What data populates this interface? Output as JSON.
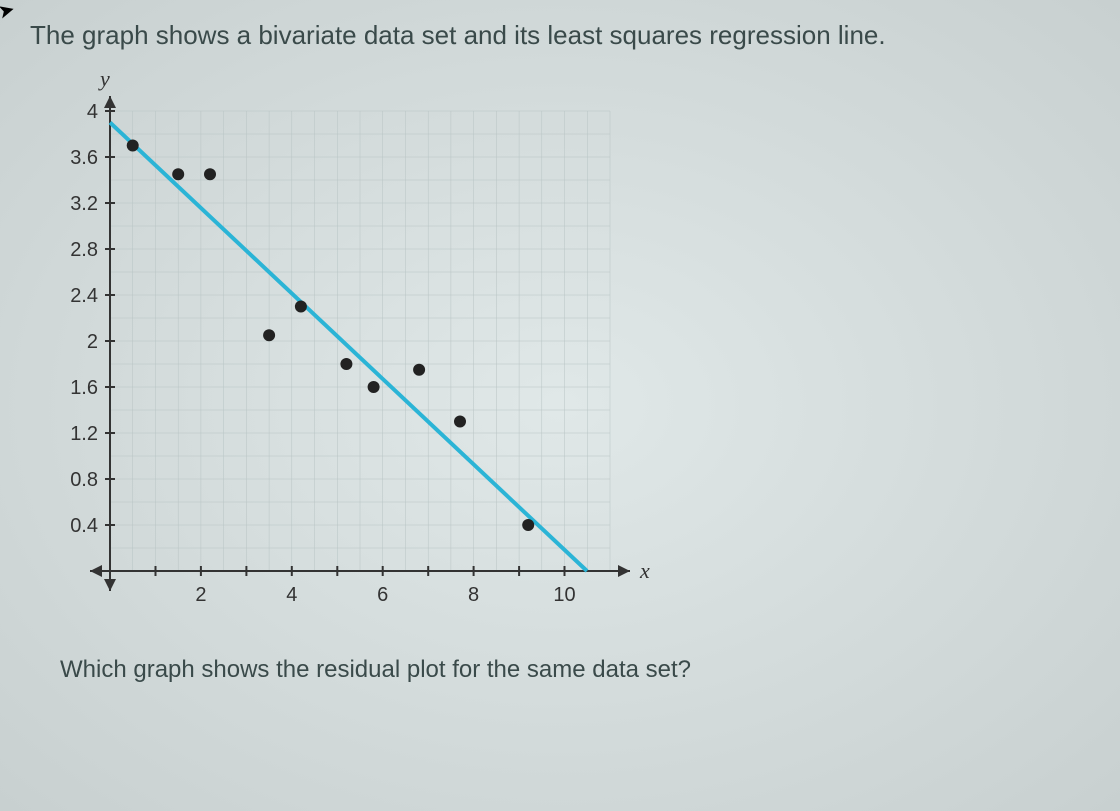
{
  "title_text": "The graph shows a bivariate data set and its least squares regression line.",
  "question_text": "Which graph shows the residual plot for the same data set?",
  "chart_data": {
    "type": "scatter",
    "title": "",
    "xlabel": "x",
    "ylabel": "y",
    "xlim": [
      0,
      11
    ],
    "ylim": [
      0,
      4
    ],
    "x_ticks": [
      2,
      4,
      6,
      8,
      10
    ],
    "y_ticks": [
      0.4,
      0.8,
      1.2,
      1.6,
      2,
      2.4,
      2.8,
      3.2,
      3.6,
      4
    ],
    "series": [
      {
        "name": "data-points",
        "type": "scatter",
        "points": [
          {
            "x": 0.5,
            "y": 3.7
          },
          {
            "x": 1.5,
            "y": 3.45
          },
          {
            "x": 2.2,
            "y": 3.45
          },
          {
            "x": 3.5,
            "y": 2.05
          },
          {
            "x": 4.2,
            "y": 2.3
          },
          {
            "x": 5.2,
            "y": 1.8
          },
          {
            "x": 5.8,
            "y": 1.6
          },
          {
            "x": 6.8,
            "y": 1.75
          },
          {
            "x": 7.7,
            "y": 1.3
          },
          {
            "x": 9.2,
            "y": 0.4
          }
        ]
      },
      {
        "name": "regression-line",
        "type": "line",
        "points": [
          {
            "x": 0,
            "y": 3.9
          },
          {
            "x": 10.5,
            "y": 0.0
          }
        ]
      }
    ]
  }
}
